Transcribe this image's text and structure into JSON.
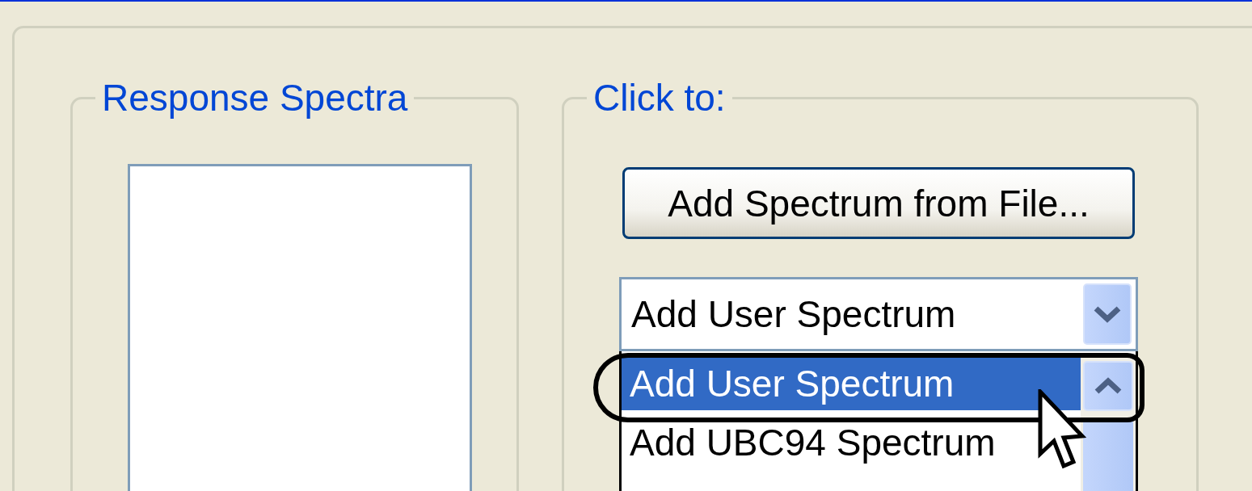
{
  "response_spectra": {
    "legend": "Response Spectra"
  },
  "click_to": {
    "legend": "Click to:",
    "button": "Add Spectrum from File...",
    "combo": {
      "value": "Add User Spectrum",
      "expanded": true,
      "options": [
        {
          "label": "Add User Spectrum",
          "selected": true
        },
        {
          "label": "Add UBC94 Spectrum",
          "selected": false
        }
      ]
    }
  }
}
